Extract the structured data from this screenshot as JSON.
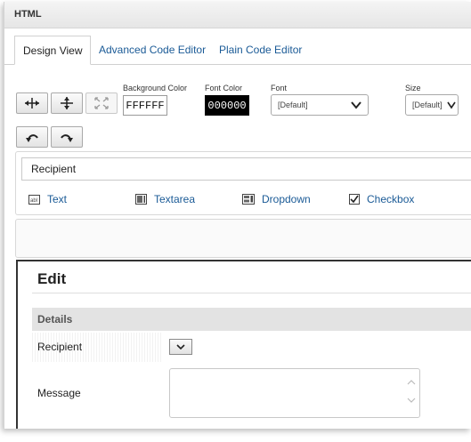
{
  "header": {
    "title": "HTML"
  },
  "tabs": [
    {
      "label": "Design View",
      "active": true
    },
    {
      "label": "Advanced Code Editor",
      "active": false
    },
    {
      "label": "Plain Code Editor",
      "active": false
    }
  ],
  "toolbar": {
    "buttons": [
      {
        "icon": "expand-horizontal-icon"
      },
      {
        "icon": "expand-vertical-icon"
      },
      {
        "icon": "fit-disabled-icon"
      },
      {
        "icon": "undo-icon"
      },
      {
        "icon": "redo-icon"
      }
    ],
    "background_color": {
      "label": "Background Color",
      "value": "FFFFFF"
    },
    "font_color": {
      "label": "Font Color",
      "value": "000000"
    },
    "font": {
      "label": "Font",
      "value": "[Default]"
    },
    "size": {
      "label": "Size",
      "value": "[Default]"
    }
  },
  "field_panel": {
    "recipient_value": "Recipient",
    "controls": [
      {
        "label": "Text",
        "icon": "text-field-icon"
      },
      {
        "label": "Textarea",
        "icon": "textarea-icon"
      },
      {
        "label": "Dropdown",
        "icon": "dropdown-icon"
      },
      {
        "label": "Checkbox",
        "icon": "checkbox-icon"
      }
    ]
  },
  "edit": {
    "title": "Edit",
    "section": "Details",
    "rows": [
      {
        "label": "Recipient"
      },
      {
        "label": "Message"
      }
    ]
  },
  "colors": {
    "link": "#1a5a96",
    "dark_box": "#000000",
    "section_bg": "#e3e3e3"
  }
}
